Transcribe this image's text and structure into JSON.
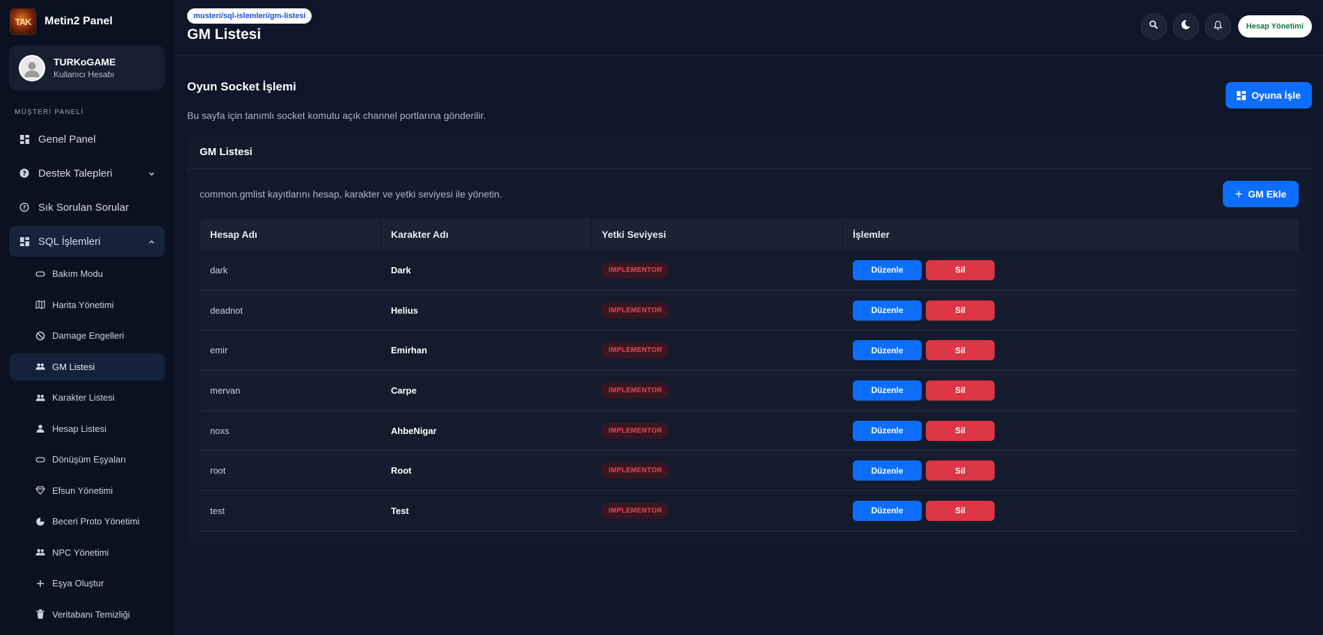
{
  "brand": {
    "name": "Metin2 Panel",
    "logo_text": "TAK"
  },
  "user": {
    "name": "TURKoGAME",
    "role": "Kullanıcı Hesabı"
  },
  "sidebar": {
    "section": "MÜŞTERİ PANELİ",
    "items": [
      {
        "label": "Genel Panel",
        "icon": "dashboard-icon"
      },
      {
        "label": "Destek Talepleri",
        "icon": "support-icon"
      },
      {
        "label": "Sık Sorulan Sorular",
        "icon": "help-icon"
      },
      {
        "label": "SQL İşlemleri",
        "icon": "dashboard-icon"
      }
    ],
    "sub_items": [
      {
        "label": "Bakım Modu",
        "icon": "toggle-icon"
      },
      {
        "label": "Harita Yönetimi",
        "icon": "map-icon"
      },
      {
        "label": "Damage Engelleri",
        "icon": "block-icon"
      },
      {
        "label": "GM Listesi",
        "icon": "users-icon"
      },
      {
        "label": "Karakter Listesi",
        "icon": "users-icon"
      },
      {
        "label": "Hesap Listesi",
        "icon": "user-icon"
      },
      {
        "label": "Dönüşüm Eşyaları",
        "icon": "toggle-icon"
      },
      {
        "label": "Efsun Yönetimi",
        "icon": "gem-icon"
      },
      {
        "label": "Beceri Proto Yönetimi",
        "icon": "skill-icon"
      },
      {
        "label": "NPC Yönetimi",
        "icon": "users-icon"
      },
      {
        "label": "Eşya Oluştur",
        "icon": "plus-icon"
      },
      {
        "label": "Veritabanı Temizliği",
        "icon": "trash-icon"
      }
    ]
  },
  "header": {
    "breadcrumb": "musteri/sql-islemleri/gm-listesi",
    "title": "GM Listesi",
    "account_button": "Hesap Yönetimi"
  },
  "socket": {
    "title": "Oyun Socket İşlemi",
    "description": "Bu sayfa için tanımlı socket komutu açık channel portlarına gönderilir.",
    "button": "Oyuna İşle"
  },
  "card": {
    "title": "GM Listesi",
    "description": "common.gmlist kayıtlarını hesap, karakter ve yetki seviyesi ile yönetin.",
    "add_button": "GM Ekle"
  },
  "table": {
    "columns": [
      "Hesap Adı",
      "Karakter Adı",
      "Yetki Seviyesi",
      "İşlemler"
    ],
    "edit_label": "Düzenle",
    "delete_label": "Sil",
    "rows": [
      {
        "account": "dark",
        "character": "Dark",
        "level": "IMPLEMENTOR"
      },
      {
        "account": "deadnot",
        "character": "Helius",
        "level": "IMPLEMENTOR"
      },
      {
        "account": "emir",
        "character": "Emirhan",
        "level": "IMPLEMENTOR"
      },
      {
        "account": "mervan",
        "character": "Carpe",
        "level": "IMPLEMENTOR"
      },
      {
        "account": "noxs",
        "character": "AhbeNigar",
        "level": "IMPLEMENTOR"
      },
      {
        "account": "root",
        "character": "Root",
        "level": "IMPLEMENTOR"
      },
      {
        "account": "test",
        "character": "Test",
        "level": "IMPLEMENTOR"
      }
    ]
  },
  "colors": {
    "accent": "#0d6efd",
    "danger": "#dc3545",
    "background": "#0f1629",
    "sidebar": "#0b1120"
  }
}
